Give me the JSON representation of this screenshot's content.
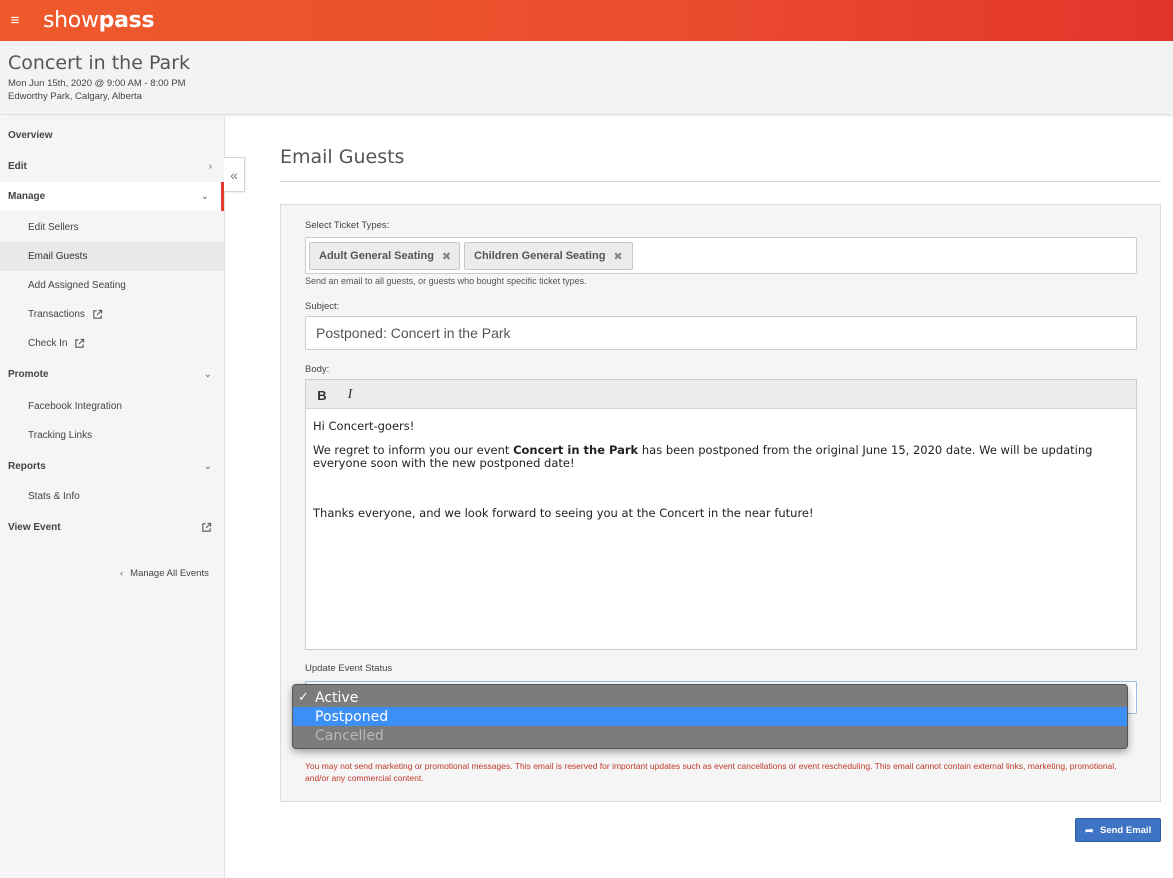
{
  "app": {
    "logo_light": "show",
    "logo_bold": "pass",
    "menu_icon": "hamburger-icon"
  },
  "event": {
    "title": "Concert in the Park",
    "date": "Mon Jun 15th, 2020 @ 9:00 AM - 8:00 PM",
    "location": "Edworthy Park, Calgary, Alberta"
  },
  "sidebar": {
    "overview": "Overview",
    "edit": "Edit",
    "manage": "Manage",
    "manage_items": [
      "Edit Sellers",
      "Email Guests",
      "Add Assigned Seating",
      "Transactions",
      "Check In"
    ],
    "promote": "Promote",
    "promote_items": [
      "Facebook Integration",
      "Tracking Links"
    ],
    "reports": "Reports",
    "reports_items": [
      "Stats & Info"
    ],
    "view_event": "View Event",
    "manage_all": "Manage All Events",
    "collapse_glyph": "«"
  },
  "main": {
    "page_title": "Email Guests",
    "ticket_label": "Select Ticket Types:",
    "ticket_chips": [
      "Adult General Seating",
      "Children General Seating"
    ],
    "chip_remove": "✖",
    "ticket_help": "Send an email to all guests, or guests who bought specific ticket types.",
    "subject_label": "Subject:",
    "subject_value": "Postponed: Concert in the Park",
    "body_label": "Body:",
    "toolbar": {
      "bold": "B",
      "italic": "I"
    },
    "body": {
      "greeting": "Hi Concert-goers!",
      "line_pre": "We regret to inform you our event ",
      "line_bold": "Concert in the Park",
      "line_post": " has been postponed from the original June 15, 2020 date. We will be updating everyone soon with the new postponed date!",
      "closing": "Thanks everyone, and we look forward to seeing you at the Concert in the near future!"
    },
    "status_label": "Update Event Status",
    "status_options": [
      "Active",
      "Postponed",
      "Cancelled"
    ],
    "warning": "You may not send marketing or promotional messages. This email is reserved for important updates such as event cancellations or event rescheduling. This email cannot contain external links, marketing, promotional, and/or any commercial content.",
    "send_label": "Send Email"
  },
  "colors": {
    "brand": "#ea4b2e",
    "primary_button": "#3f74c5",
    "highlight": "#3b8ff6",
    "warning": "#c0392b"
  }
}
